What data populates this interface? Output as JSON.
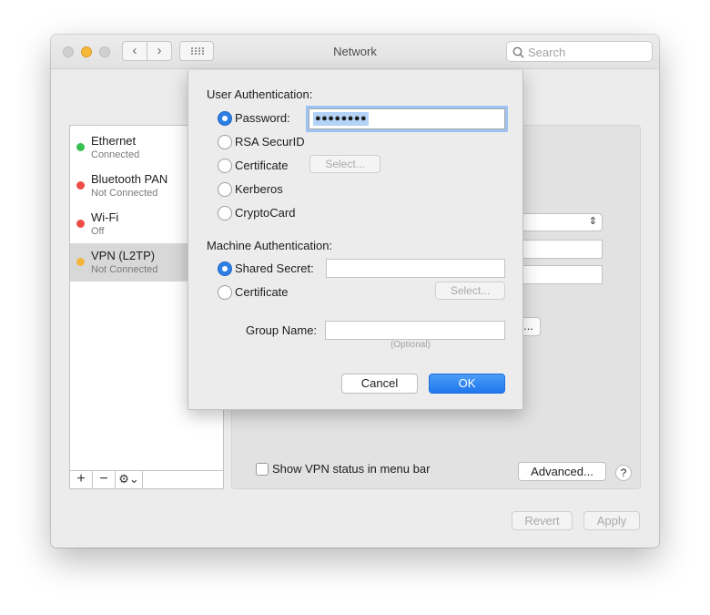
{
  "window": {
    "title": "Network",
    "search_placeholder": "Search"
  },
  "sidebar": {
    "items": [
      {
        "name": "Ethernet",
        "status": "Connected",
        "dot_color": "#3ac050"
      },
      {
        "name": "Bluetooth PAN",
        "status": "Not Connected",
        "dot_color": "#ee4c47"
      },
      {
        "name": "Wi-Fi",
        "status": "Off",
        "dot_color": "#ee4c47"
      },
      {
        "name": "VPN (L2TP)",
        "status": "Not Connected",
        "dot_color": "#f3b53e"
      }
    ],
    "add_label": "+",
    "remove_label": "−",
    "gear_label": "⚙⌄"
  },
  "panel": {
    "show_status_label": "Show VPN status in menu bar",
    "advanced_label": "Advanced...",
    "help_label": "?",
    "partial_button_label": "..."
  },
  "footer": {
    "revert_label": "Revert",
    "apply_label": "Apply"
  },
  "sheet": {
    "user_auth_title": "User Authentication:",
    "user_options": [
      {
        "label": "Password:",
        "selected": true
      },
      {
        "label": "RSA SecurID",
        "selected": false
      },
      {
        "label": "Certificate",
        "selected": false
      },
      {
        "label": "Kerberos",
        "selected": false
      },
      {
        "label": "CryptoCard",
        "selected": false
      }
    ],
    "password_value": "●●●●●●●●",
    "user_select_label": "Select...",
    "machine_auth_title": "Machine Authentication:",
    "machine_options": [
      {
        "label": "Shared Secret:",
        "selected": true
      },
      {
        "label": "Certificate",
        "selected": false
      }
    ],
    "machine_select_label": "Select...",
    "group_name_label": "Group Name:",
    "group_name_hint": "(Optional)",
    "cancel_label": "Cancel",
    "ok_label": "OK",
    "accent_color": "#2d7fe6"
  }
}
